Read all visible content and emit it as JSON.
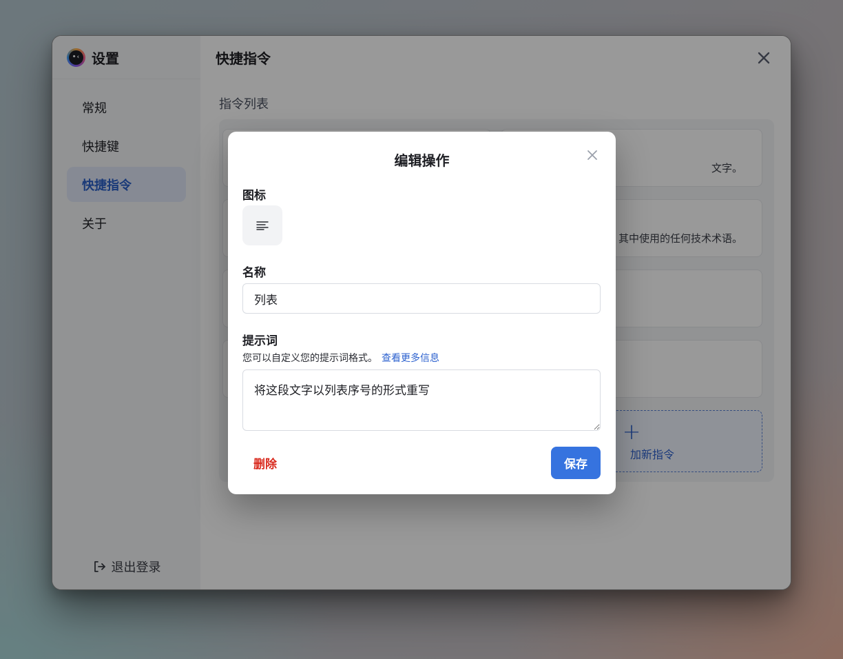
{
  "app": {
    "title": "设置"
  },
  "sidebar": {
    "items": [
      {
        "label": "常规"
      },
      {
        "label": "快捷键"
      },
      {
        "label": "快捷指令"
      },
      {
        "label": "关于"
      }
    ],
    "logout_label": "退出登录"
  },
  "main": {
    "title": "快捷指令",
    "section_title": "指令列表",
    "cards": [
      {
        "desc": "文字。"
      },
      {
        "desc": "其中使用的任何技术术语。"
      },
      {
        "desc": ""
      },
      {
        "desc": ""
      }
    ],
    "add_label": "加新指令"
  },
  "modal": {
    "title": "编辑操作",
    "icon_label": "图标",
    "icon": "align-left-icon",
    "name_label": "名称",
    "name_value": "列表",
    "prompt_label": "提示词",
    "prompt_hint": "您可以自定义您的提示词格式。",
    "prompt_link": "查看更多信息",
    "prompt_value": "将这段文字以列表序号的形式重写",
    "delete_label": "删除",
    "save_label": "保存"
  },
  "colors": {
    "accent": "#3673df",
    "danger": "#d92b1f",
    "active_nav_bg": "#dfe7f7"
  }
}
